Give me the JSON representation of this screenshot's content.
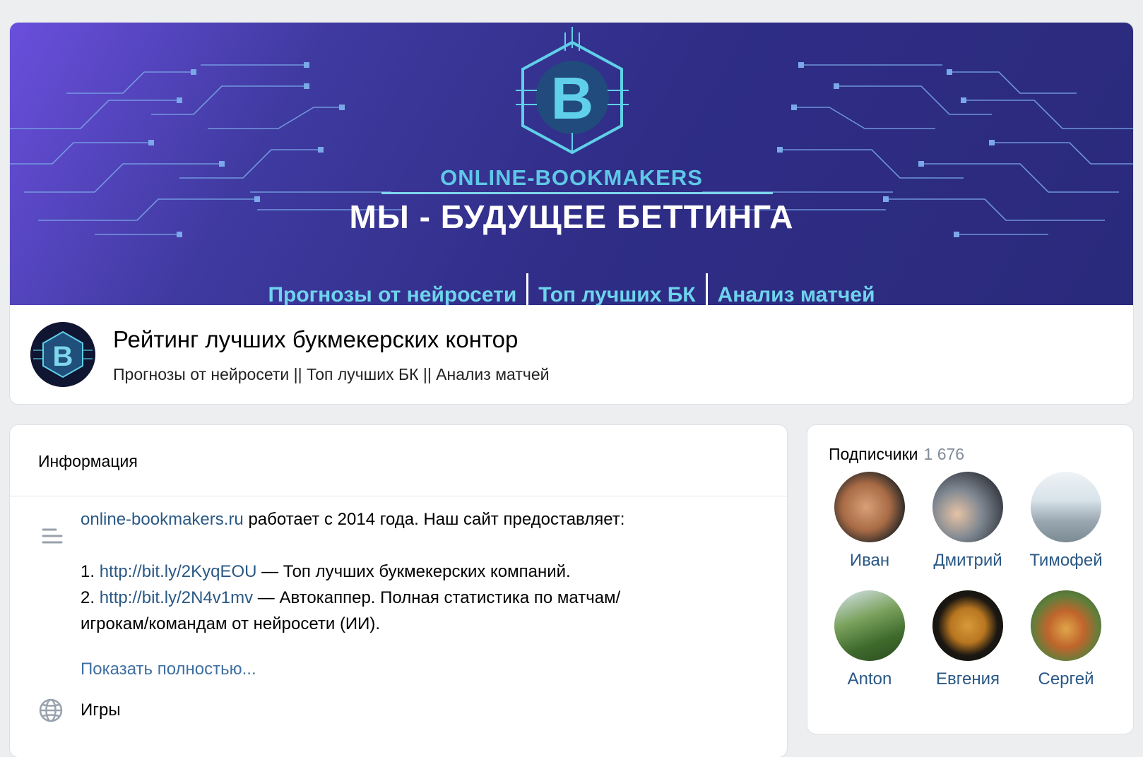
{
  "cover": {
    "brand": "ONLINE-BOOKMAKERS",
    "slogan": "МЫ - БУДУЩЕЕ БЕТТИНГА",
    "menu": [
      "Прогнозы от нейросети",
      "Топ лучших БК",
      "Анализ матчей"
    ],
    "logo_letter": "B"
  },
  "group": {
    "avatar_letter": "B",
    "title": "Рейтинг лучших букмекерских контор",
    "status": "Прогнозы от нейросети || Топ лучших БК || Анализ матчей"
  },
  "info": {
    "title": "Информация",
    "desc_link": "online-bookmakers.ru",
    "desc_text": " работает с 2014 года. Наш сайт предоставляет:",
    "item1_num": "1. ",
    "item1_link": "http://bit.ly/2KyqEOU",
    "item1_text": " — Топ лучших букмекерских компаний.",
    "item2_num": "2. ",
    "item2_link": "http://bit.ly/2N4v1mv",
    "item2_text": " — Автокаппер. Полная статистика по матчам/",
    "item2_cont": "игрокам/командам от нейросети (ИИ).",
    "show_more": "Показать полностью...",
    "category": "Игры"
  },
  "subscribers": {
    "label": "Подписчики",
    "count": "1 676",
    "people": [
      {
        "name": "Иван",
        "color": "#b07a56"
      },
      {
        "name": "Дмитрий",
        "color": "#8a8f99"
      },
      {
        "name": "Тимофей",
        "color": "#c9d7e2"
      },
      {
        "name": "Anton",
        "color": "#4f7a3a"
      },
      {
        "name": "Евгения",
        "color": "#1d1a14"
      },
      {
        "name": "Сергей",
        "color": "#b4743a"
      }
    ]
  },
  "icons": {
    "description": "text-lines-icon",
    "category": "globe-icon"
  }
}
